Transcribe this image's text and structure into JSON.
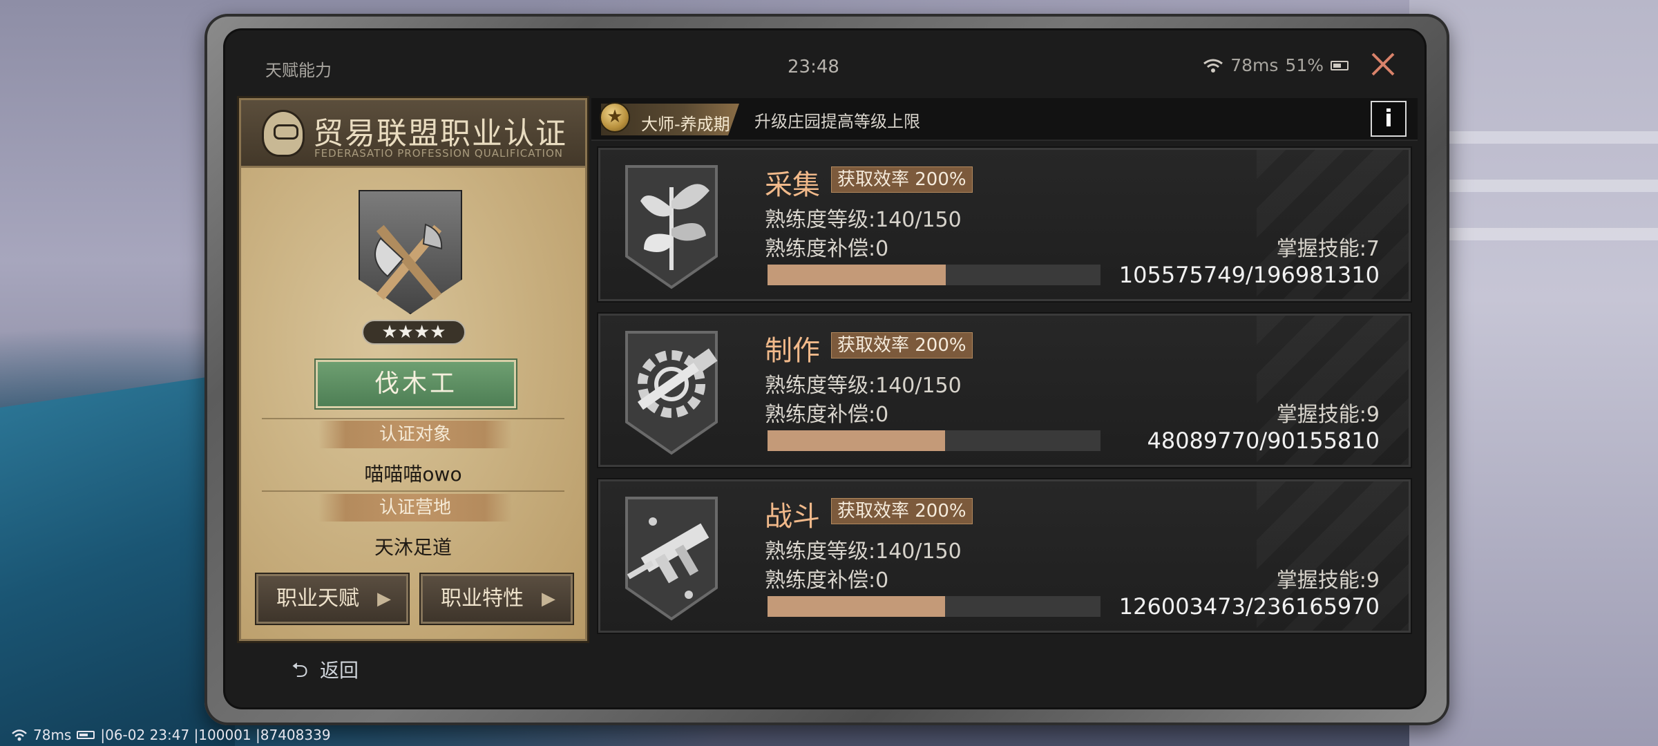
{
  "status_bar": {
    "title": "天赋能力",
    "time": "23:48",
    "ping": "78ms",
    "battery": "51%"
  },
  "certificate": {
    "title": "贸易联盟职业认证",
    "subtitle": "FEDERASATIO PROFESSION QUALIFICATION",
    "stars": "★★★★",
    "job_name": "伐木工",
    "target_label": "认证对象",
    "target_value": "喵喵喵owo",
    "camp_label": "认证营地",
    "camp_value": "天沐足道",
    "btn_talent": "职业天赋",
    "btn_trait": "职业特性"
  },
  "banner": {
    "master_label": "大师-养成期",
    "hint": "升级庄园提高等级上限",
    "info": "i"
  },
  "skills": [
    {
      "name": "采集",
      "efficiency": "获取效率 200%",
      "level": "熟练度等级:140/150",
      "compensation": "熟练度补偿:0",
      "mastery": "掌握技能:7",
      "progress_text": "105575749/196981310",
      "progress": 0.536,
      "icon": "herb-icon"
    },
    {
      "name": "制作",
      "efficiency": "获取效率 200%",
      "level": "熟练度等级:140/150",
      "compensation": "熟练度补偿:0",
      "mastery": "掌握技能:9",
      "progress_text": "48089770/90155810",
      "progress": 0.533,
      "icon": "gear-hammer-icon"
    },
    {
      "name": "战斗",
      "efficiency": "获取效率 200%",
      "level": "熟练度等级:140/150",
      "compensation": "熟练度补偿:0",
      "mastery": "掌握技能:9",
      "progress_text": "126003473/236165970",
      "progress": 0.534,
      "icon": "smg-icon"
    }
  ],
  "back_label": "返回",
  "overlay": {
    "ping": "78ms",
    "info": "|06-02 23:47 |100001 |87408339"
  },
  "colors": {
    "accent_orange": "#f1b98a",
    "progress": "#c49a78",
    "close": "#d9826a",
    "job_green": "#5e8f63"
  }
}
